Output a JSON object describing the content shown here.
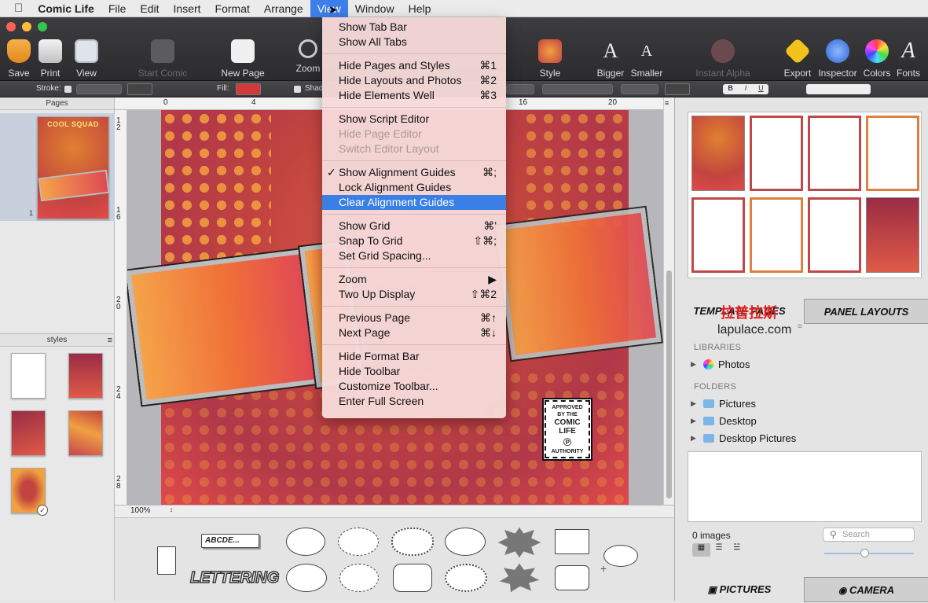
{
  "menubar": {
    "apple": "",
    "app_name": "Comic Life",
    "items": [
      "File",
      "Edit",
      "Insert",
      "Format",
      "Arrange",
      "View",
      "Window",
      "Help"
    ]
  },
  "toolbar": {
    "save": "Save",
    "print": "Print",
    "view": "View",
    "start_comic": "Start Comic",
    "new_page": "New Page",
    "zoom": "Zoom",
    "style": "Style",
    "bigger": "Bigger",
    "smaller": "Smaller",
    "instant_alpha": "Instant Alpha",
    "export": "Export",
    "inspector": "Inspector",
    "colors": "Colors",
    "fonts": "Fonts"
  },
  "formatbar": {
    "stroke": "Stroke:",
    "fill": "Fill:",
    "shadow": "Shad",
    "bold": "B",
    "italic": "I",
    "underline": "U"
  },
  "pages_panel": {
    "title": "Pages",
    "page_number": "1",
    "cover_title": "COOL SQUAD"
  },
  "styles_panel": {
    "title": "styles"
  },
  "rulers": {
    "h": [
      "0",
      "4",
      "16",
      "20"
    ],
    "v": [
      "1",
      "2",
      "1",
      "6",
      "2",
      "0",
      "2",
      "4",
      "2",
      "8"
    ]
  },
  "canvas": {
    "zoom_value": "100%",
    "stamp_lines": [
      "APPROVED",
      "BY THE",
      "COMIC",
      "LIFE",
      "AUTHORITY"
    ]
  },
  "well": {
    "caption": "ABCDE...",
    "lettering": "LETTERING"
  },
  "view_menu": {
    "groups": [
      [
        {
          "label": "Show Tab Bar",
          "shortcut": "",
          "disabled": false
        },
        {
          "label": "Show All Tabs",
          "shortcut": "",
          "disabled": false
        }
      ],
      [
        {
          "label": "Hide Pages and Styles",
          "shortcut": "⌘1",
          "disabled": false
        },
        {
          "label": "Hide Layouts and Photos",
          "shortcut": "⌘2",
          "disabled": false
        },
        {
          "label": "Hide Elements Well",
          "shortcut": "⌘3",
          "disabled": false
        }
      ],
      [
        {
          "label": "Show Script Editor",
          "shortcut": "",
          "disabled": false
        },
        {
          "label": "Hide Page Editor",
          "shortcut": "",
          "disabled": true
        },
        {
          "label": "Switch Editor Layout",
          "shortcut": "",
          "disabled": true
        }
      ],
      [
        {
          "label": "Show Alignment Guides",
          "shortcut": "⌘;",
          "disabled": false,
          "checked": true
        },
        {
          "label": "Lock Alignment Guides",
          "shortcut": "",
          "disabled": false
        },
        {
          "label": "Clear Alignment Guides",
          "shortcut": "",
          "disabled": false,
          "highlighted": true
        }
      ],
      [
        {
          "label": "Show Grid",
          "shortcut": "⌘'",
          "disabled": false
        },
        {
          "label": "Snap To Grid",
          "shortcut": "⇧⌘;",
          "disabled": false
        },
        {
          "label": "Set Grid Spacing...",
          "shortcut": "",
          "disabled": false
        }
      ],
      [
        {
          "label": "Zoom",
          "shortcut": "▶",
          "disabled": false
        },
        {
          "label": "Two Up Display",
          "shortcut": "⇧⌘2",
          "disabled": false
        }
      ],
      [
        {
          "label": "Previous Page",
          "shortcut": "⌘↑",
          "disabled": false
        },
        {
          "label": "Next Page",
          "shortcut": "⌘↓",
          "disabled": false
        }
      ],
      [
        {
          "label": "Hide Format Bar",
          "shortcut": "",
          "disabled": false
        },
        {
          "label": "Hide Toolbar",
          "shortcut": "",
          "disabled": false
        },
        {
          "label": "Customize Toolbar...",
          "shortcut": "",
          "disabled": false
        },
        {
          "label": "Enter Full Screen",
          "shortcut": "",
          "disabled": false
        }
      ]
    ]
  },
  "right_panel": {
    "tab_templates": "TEMPLATE PAGES",
    "tab_panel_layouts": "PANEL LAYOUTS",
    "watermark_cn": "拉普拉斯",
    "watermark_url": "lapulace.com",
    "libraries_label": "LIBRARIES",
    "libraries": [
      "Photos"
    ],
    "folders_label": "FOLDERS",
    "folders": [
      "Pictures",
      "Desktop",
      "Desktop Pictures"
    ],
    "image_count": "0 images",
    "search_placeholder": "Search",
    "tab_pictures": "PICTURES",
    "tab_camera": "CAMERA"
  },
  "colors": {
    "menu_highlight": "#3a7fe6",
    "toolbar_bg": "#2f2f32",
    "page_red": "#c2443f",
    "dot_orange": "#f3a041"
  }
}
